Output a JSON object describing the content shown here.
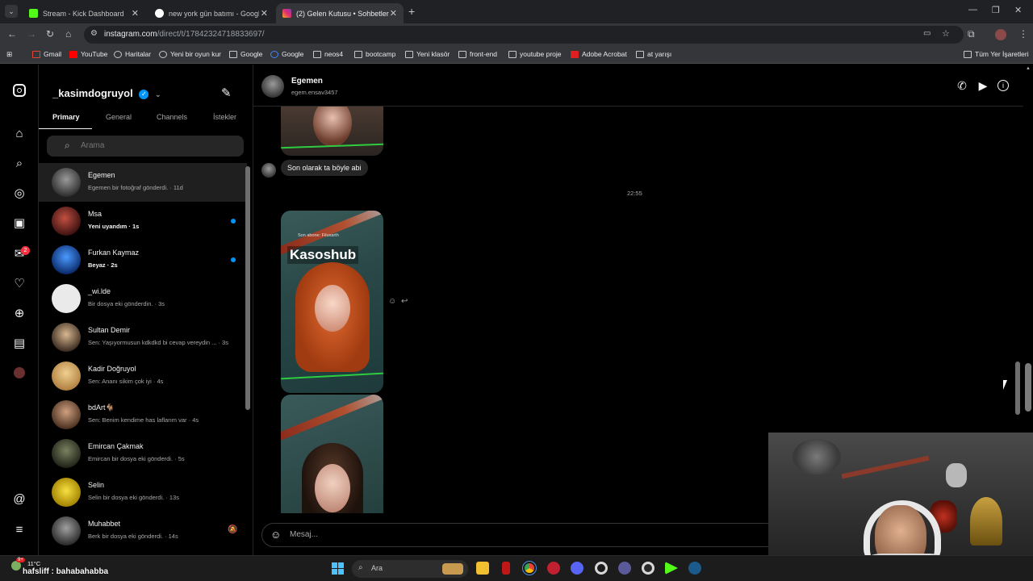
{
  "browser": {
    "tabs": [
      {
        "title": "Stream - Kick Dashboard",
        "color": "#53fc18"
      },
      {
        "title": "new york gün batımı - Google'da",
        "color": "#4285f4"
      },
      {
        "title": "(2) Gelen Kutusu • Sohbetler",
        "color": "#e1306c"
      }
    ],
    "url_host": "instagram.com",
    "url_path": "/direct/t/17842324718833697/",
    "bookmarks": [
      "Gmail",
      "YouTube",
      "Haritalar",
      "Yeni bir oyun kur",
      "Google",
      "Google",
      "neos4",
      "bootcamp",
      "Yeni klasör",
      "front-end",
      "youtube proje",
      "Adobe Acrobat",
      "at yarışı"
    ],
    "all_bookmarks": "Tüm Yer İşaretleri"
  },
  "rail": {
    "icons": [
      "instagram-icon",
      "home-icon",
      "search-icon",
      "explore-icon",
      "reels-icon",
      "messages-icon",
      "heart-icon",
      "create-icon",
      "dashboard-icon",
      "profile-icon",
      "threads-icon",
      "menu-icon"
    ],
    "messages_badge": "2"
  },
  "inbox": {
    "username": "_kasimdogruyol",
    "tabs": [
      "Primary",
      "General",
      "Channels",
      "İstekler"
    ],
    "search_placeholder": "Arama",
    "conversations": [
      {
        "name": "Egemen",
        "preview": "Egemen bir fotoğraf gönderdi. · 11d",
        "selected": true,
        "unread": false,
        "color": "#5a5a5a"
      },
      {
        "name": "Msa",
        "preview": "Yeni uyandım · 1s",
        "bold": true,
        "unread": true,
        "color": "#8a2b2b"
      },
      {
        "name": "Furkan Kaymaz",
        "preview": "Beyaz · 2s",
        "bold": true,
        "unread": true,
        "color": "#1e5fb8"
      },
      {
        "name": "_wi.lde",
        "preview": "Bir dosya eki gönderdin. · 3s",
        "unread": false,
        "color": "#e8e8e8"
      },
      {
        "name": "Sultan Demir",
        "preview": "Sen: Yaşıyormusun kdkdkd bi cevap vereydin ... · 3s",
        "unread": false,
        "color": "#b5946e"
      },
      {
        "name": "Kadir Doğruyol",
        "preview": "Sen: Ananı sikim çok iyi · 4s",
        "unread": false,
        "color": "#e8c080"
      },
      {
        "name": "bdArt🐐",
        "preview": "Sen: Benim kendime has laflarım var · 4s",
        "unread": false,
        "color": "#a07860"
      },
      {
        "name": "Emircan Çakmak",
        "preview": "Emircan bir dosya eki gönderdi. · 5s",
        "unread": false,
        "color": "#4a4f3a"
      },
      {
        "name": "Selin",
        "preview": "Selin bir dosya eki gönderdi. · 13s",
        "unread": false,
        "color": "#e8d020"
      },
      {
        "name": "Muhabbet",
        "preview": "Berk bir dosya eki gönderdi. · 14s",
        "unread": false,
        "muted": true,
        "color": "#6a6a6a"
      }
    ]
  },
  "chat": {
    "name": "Egemen",
    "handle": "egem.ensav3457",
    "message": "Son olarak ta böyle abi",
    "timestamp": "22:55",
    "photo_caption_small": "Son abone: Filuxarth",
    "photo_caption_big": "Kasoshub",
    "composer_placeholder": "Mesaj...",
    "header_icons": [
      "phone-icon",
      "video-icon",
      "info-icon"
    ]
  },
  "taskbar": {
    "search_label": "Ara",
    "weather": "11°C",
    "notification_count": "9+",
    "overlay_chat": "hafsliff : bahabahabba"
  }
}
